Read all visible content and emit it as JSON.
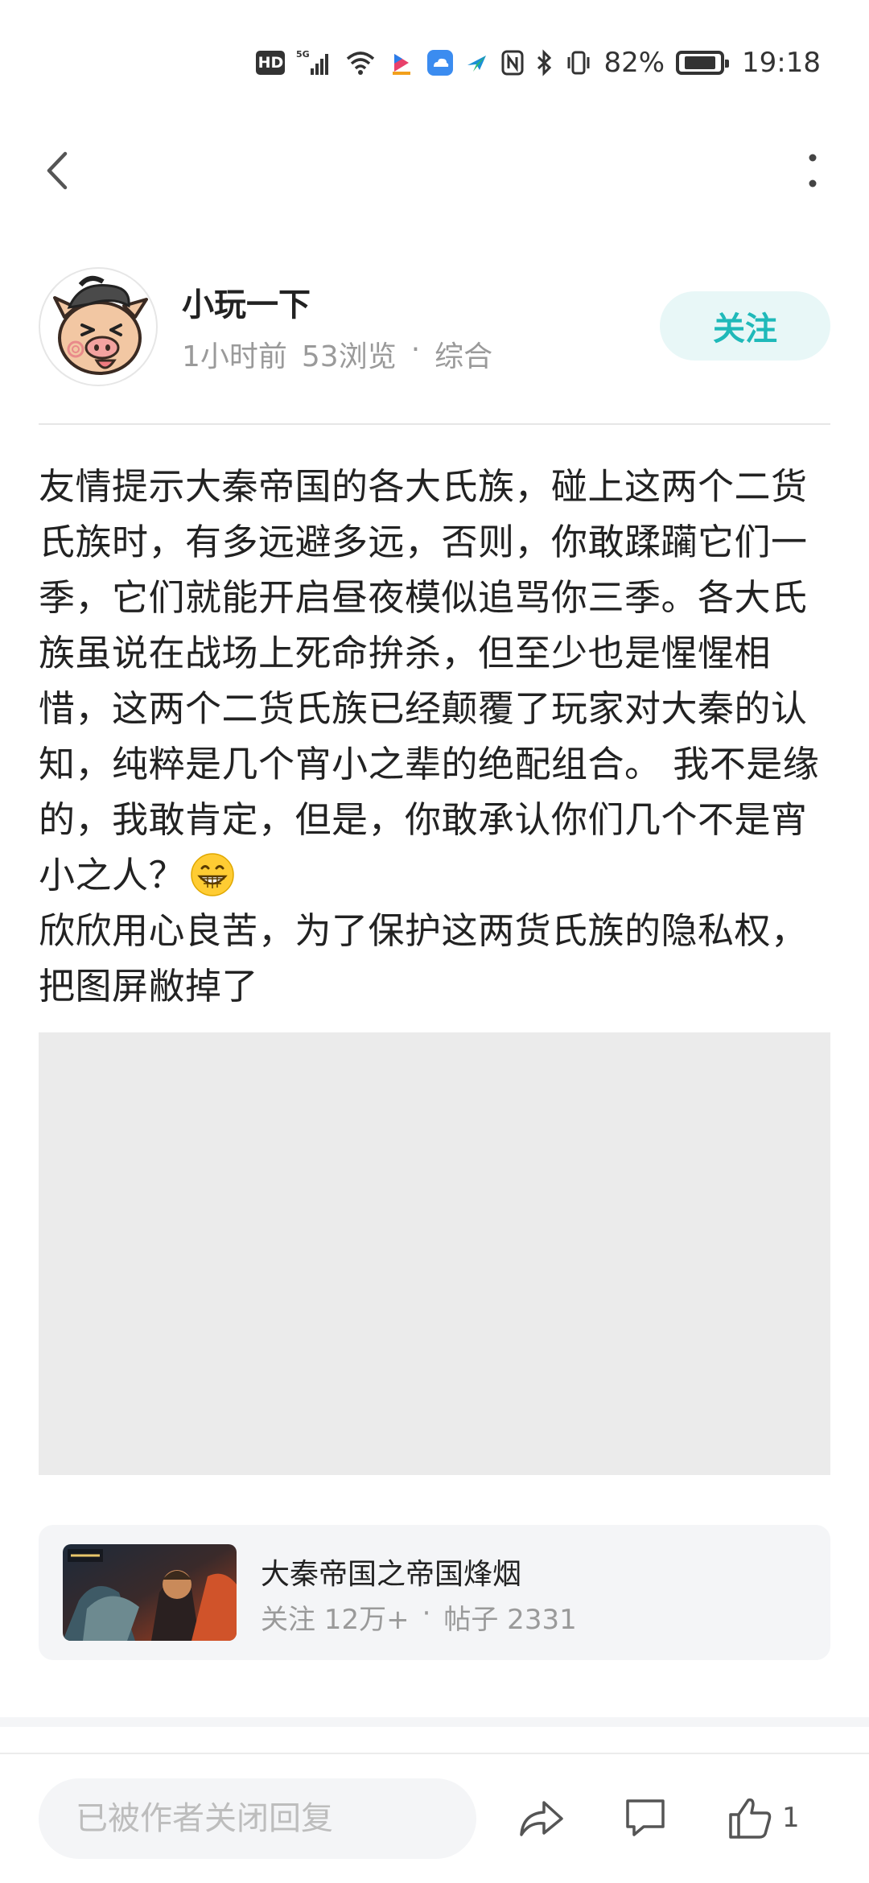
{
  "status_bar": {
    "network": "5G",
    "battery": "82%",
    "battery_level": 0.82,
    "time": "19:18",
    "hd_label": "HD"
  },
  "nav": {
    "back_icon": "chevron-left-icon",
    "more_icon": "more-vertical-icon"
  },
  "author": {
    "name": "小玩一下",
    "time_ago": "1小时前",
    "views": "53浏览",
    "separator": "·",
    "category": "综合",
    "follow_label": "关注"
  },
  "post": {
    "paragraphs": [
      "友情提示大秦帝国的各大氏族，碰上这两个二货氏族时，有多远避多远，否则，你敢蹂躏它们一季，它们就能开启昼夜模似追骂你三季。各大氏族虽说在战场上死命拚杀，但至少也是惺惺相惜，这两个二货氏族已经颠覆了玩家对大秦的认知，纯粹是几个宵小之辈的绝配组合。 我不是缘的，我敢肯定，但是，你敢承认你们几个不是宵小之人？",
      "欣欣用心良苦，为了保护这两货氏族的隐私权，把图屏敝掉了"
    ],
    "emoji": "grinning-face-emoji"
  },
  "game_card": {
    "name": "大秦帝国之帝国烽烟",
    "followers": "关注 12万+",
    "separator": "·",
    "posts": "帖子 2331"
  },
  "bottom_bar": {
    "reply_placeholder": "已被作者关闭回复",
    "like_count": "1"
  },
  "colors": {
    "accent": "#1fb9b9",
    "follow_bg": "#e8f7f7",
    "muted_text": "#9a9a9a",
    "card_bg": "#f4f5f7",
    "image_placeholder": "#ebebeb"
  }
}
